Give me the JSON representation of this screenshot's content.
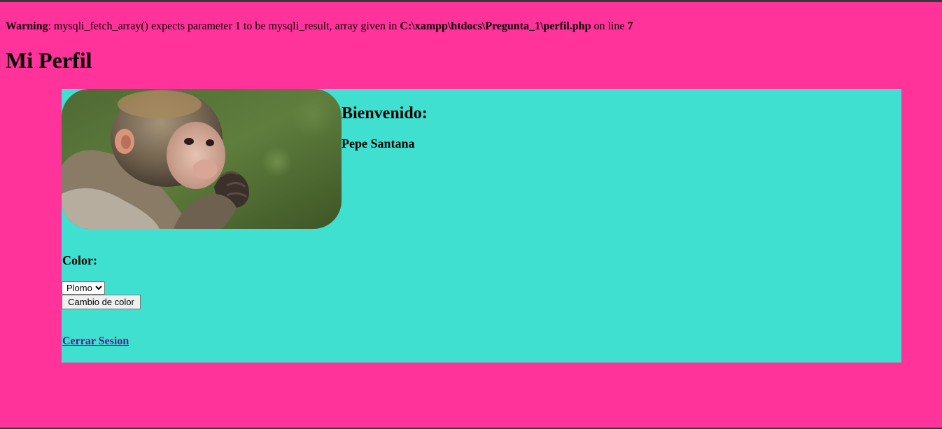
{
  "warning": {
    "label": "Warning",
    "message_pre": ": mysqli_fetch_array() expects parameter 1 to be mysqli_result, array given in ",
    "file_path": "C:\\xampp\\htdocs\\Pregunta_1\\perfil.php",
    "message_mid": " on line ",
    "line_number": "7"
  },
  "page": {
    "title": "Mi Perfil",
    "background_color": "#ff3399"
  },
  "profile": {
    "card_color": "#40e0d0",
    "photo_icon": "monkey-photo",
    "welcome_heading": "Bienvenido:",
    "user_name": "Pepe Santana"
  },
  "color_form": {
    "label": "Color:",
    "selected_option": "Plomo",
    "button_label": "Cambio de color"
  },
  "logout": {
    "label": "Cerrar Sesion",
    "color": "#551a8b"
  }
}
